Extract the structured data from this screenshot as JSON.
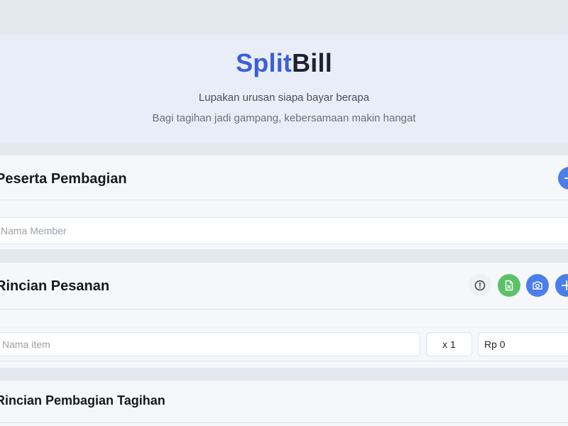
{
  "brand": {
    "name_part1": "Split",
    "name_part2": "Bill",
    "tagline": "Lupakan urusan siapa bayar berapa",
    "subtagline": "Bagi tagihan jadi gampang, kebersamaan makin hangat",
    "accent_color": "#3b5fd9"
  },
  "participants": {
    "title": "Peserta Pembagian",
    "member_input_placeholder": "Nama Member",
    "add_icon": "plus-icon"
  },
  "orders": {
    "title": "Rincian Pesanan",
    "actions": [
      {
        "icon": "info-icon",
        "color": "#eef0f3"
      },
      {
        "icon": "spreadsheet-icon",
        "color": "#5cc26a"
      },
      {
        "icon": "camera-icon",
        "color": "#4a7ee8"
      },
      {
        "icon": "plus-icon",
        "color": "#4a7ee8"
      }
    ],
    "item": {
      "name_placeholder": "Nama item",
      "quantity": "x 1",
      "price": "Rp 0"
    }
  },
  "split": {
    "title": "Rincian Pembagian Tagihan"
  }
}
